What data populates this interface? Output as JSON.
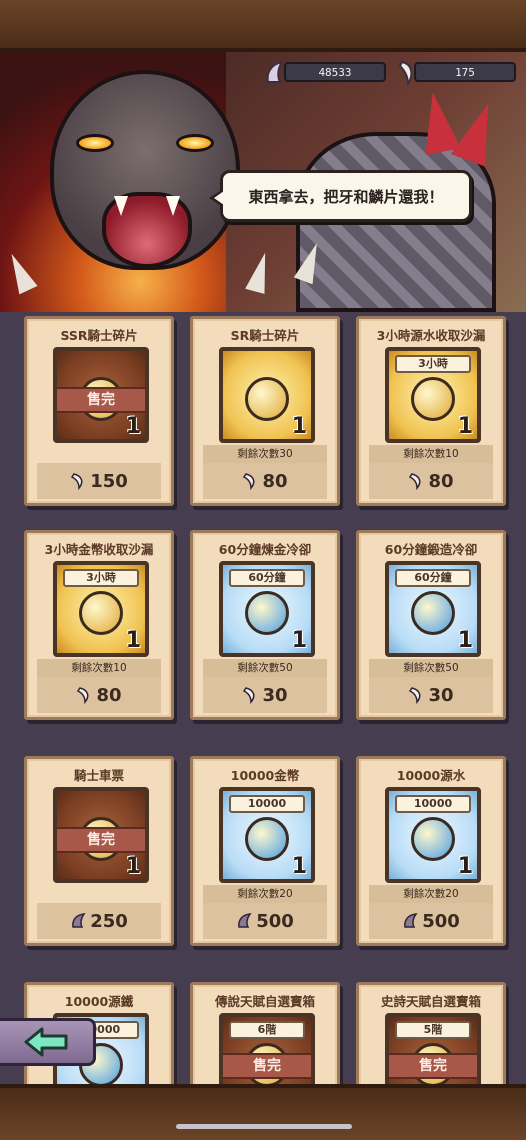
{
  "header": {
    "currency": [
      {
        "icon": "dragon-scale-icon",
        "value": "48533"
      },
      {
        "icon": "dragon-tooth-icon",
        "value": "175"
      }
    ],
    "speech": "東西拿去，把牙和鱗片還我！"
  },
  "shop": {
    "items": [
      {
        "title": "SSR騎士碎片",
        "tag": "",
        "qty": "1",
        "remaining": "",
        "price": "150",
        "sold_out": true,
        "sold_label": "售完",
        "icon": "knight-shard-icon",
        "currency": "dragon-tooth-icon",
        "style": "brown"
      },
      {
        "title": "SR騎士碎片",
        "tag": "",
        "qty": "1",
        "remaining": "剩餘次數30",
        "price": "80",
        "sold_out": false,
        "icon": "puzzle-piece-icon",
        "currency": "dragon-tooth-icon",
        "style": "gold"
      },
      {
        "title": "3小時源水收取沙漏",
        "tag": "3小時",
        "qty": "1",
        "remaining": "剩餘次數10",
        "price": "80",
        "sold_out": false,
        "icon": "water-hourglass-icon",
        "currency": "dragon-tooth-icon",
        "style": "gold"
      },
      {
        "title": "3小時金幣收取沙漏",
        "tag": "3小時",
        "qty": "1",
        "remaining": "剩餘次數10",
        "price": "80",
        "sold_out": false,
        "icon": "coin-hourglass-icon",
        "currency": "dragon-tooth-icon",
        "style": "gold"
      },
      {
        "title": "60分鐘煉金冷卻",
        "tag": "60分鐘",
        "qty": "1",
        "remaining": "剩餘次數50",
        "price": "30",
        "sold_out": false,
        "icon": "alchemy-clock-icon",
        "currency": "dragon-tooth-icon",
        "style": "blue"
      },
      {
        "title": "60分鐘鍛造冷卻",
        "tag": "60分鐘",
        "qty": "1",
        "remaining": "剩餘次數50",
        "price": "30",
        "sold_out": false,
        "icon": "forge-clock-icon",
        "currency": "dragon-tooth-icon",
        "style": "blue"
      },
      {
        "title": "騎士車票",
        "tag": "",
        "qty": "1",
        "remaining": "",
        "price": "250",
        "sold_out": true,
        "sold_label": "售完",
        "icon": "knight-ticket-icon",
        "currency": "dragon-scale-icon",
        "style": "brown"
      },
      {
        "title": "10000金幣",
        "tag": "10000",
        "qty": "1",
        "remaining": "剩餘次數20",
        "price": "500",
        "sold_out": false,
        "icon": "gold-coin-icon",
        "currency": "dragon-scale-icon",
        "style": "blue"
      },
      {
        "title": "10000源水",
        "tag": "10000",
        "qty": "1",
        "remaining": "剩餘次數20",
        "price": "500",
        "sold_out": false,
        "icon": "water-drop-icon",
        "currency": "dragon-scale-icon",
        "style": "blue"
      },
      {
        "title": "10000源鐵",
        "tag": "10000",
        "qty": "",
        "remaining": "",
        "price": "",
        "sold_out": false,
        "icon": "iron-ore-icon",
        "currency": "",
        "style": "blue"
      },
      {
        "title": "傳說天賦自選寶箱",
        "tag": "6階",
        "qty": "",
        "remaining": "",
        "price": "",
        "sold_out": true,
        "sold_label": "售完",
        "icon": "legend-chest-icon",
        "currency": "",
        "style": "brown"
      },
      {
        "title": "史詩天賦自選寶箱",
        "tag": "5階",
        "qty": "",
        "remaining": "",
        "price": "",
        "sold_out": true,
        "sold_label": "售完",
        "icon": "epic-chest-icon",
        "currency": "",
        "style": "brown"
      }
    ]
  },
  "colors": {
    "accent": "#f0c250",
    "panel": "#f2dcbb",
    "background": "#463e50",
    "soldout": "#a85848"
  }
}
